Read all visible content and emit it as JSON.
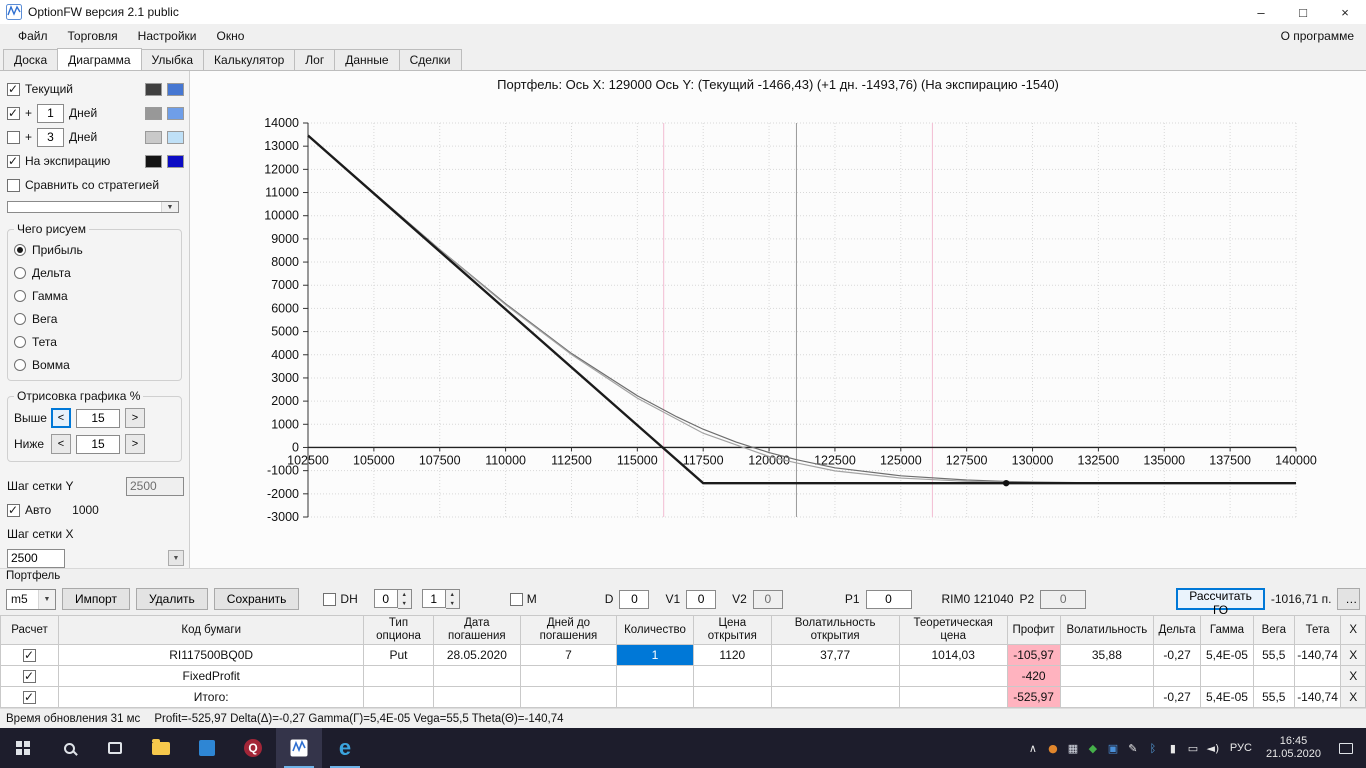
{
  "titlebar": {
    "title": "OptionFW версия 2.1 public",
    "minimize": "–",
    "maximize": "□",
    "close": "×"
  },
  "menubar": {
    "items": [
      {
        "id": "file",
        "label": "Файл"
      },
      {
        "id": "trading",
        "label": "Торговля"
      },
      {
        "id": "settings",
        "label": "Настройки"
      },
      {
        "id": "window",
        "label": "Окно"
      }
    ],
    "right": "О программе"
  },
  "tabs": {
    "items": [
      {
        "id": "board",
        "label": "Доска"
      },
      {
        "id": "diagram",
        "label": "Диаграмма"
      },
      {
        "id": "smile",
        "label": "Улыбка"
      },
      {
        "id": "calculator",
        "label": "Калькулятор"
      },
      {
        "id": "log",
        "label": "Лог"
      },
      {
        "id": "data",
        "label": "Данные"
      },
      {
        "id": "deals",
        "label": "Сделки"
      }
    ],
    "active_id": "diagram"
  },
  "sidebar": {
    "rows": {
      "current": {
        "label": "Текущий",
        "checked": true,
        "colors": [
          "#3f3f3f",
          "#4677d2"
        ]
      },
      "plus1": {
        "prefix": "+",
        "value": "1",
        "label": "Дней",
        "checked": true,
        "colors": [
          "#989898",
          "#6f9ee8"
        ]
      },
      "plus3": {
        "prefix": "+",
        "value": "3",
        "label": "Дней",
        "checked": false,
        "colors": [
          "#c9c9c9",
          "#bfe0f7"
        ]
      },
      "expiry": {
        "label": "На экспирацию",
        "checked": true,
        "colors": [
          "#141414",
          "#0b0bc4"
        ]
      },
      "compare": {
        "label": "Сравнить со стратегией",
        "checked": false
      }
    },
    "strategy_value": "",
    "draw_group": {
      "title": "Чего рисуем",
      "options": [
        {
          "id": "profit",
          "label": "Прибыль"
        },
        {
          "id": "delta",
          "label": "Дельта"
        },
        {
          "id": "gamma",
          "label": "Гамма"
        },
        {
          "id": "vega",
          "label": "Вега"
        },
        {
          "id": "theta",
          "label": "Тета"
        },
        {
          "id": "vomma",
          "label": "Вомма"
        }
      ],
      "selected": "profit"
    },
    "render_group": {
      "title": "Отрисовка графика %",
      "dec_label": "<",
      "inc_label": ">",
      "rows": [
        {
          "label": "Выше",
          "value": "15"
        },
        {
          "label": "Ниже",
          "value": "15"
        }
      ]
    },
    "grid_y": {
      "label": "Шаг сетки Y",
      "value": "2500"
    },
    "auto": {
      "label": "Авто",
      "value": "1000",
      "checked": true
    },
    "grid_x": {
      "label": "Шаг сетки X",
      "value": "2500"
    }
  },
  "chart_data": {
    "type": "line",
    "title": "Портфель:  Ось X: 129000 Ось Y:  (Текущий -1466,43)  (+1 дн. -1493,76)  (На экспирацию -1540)",
    "xlim": [
      102500,
      140000
    ],
    "ylim": [
      -3000,
      14000
    ],
    "x_tick_step": 2500,
    "y_tick_step": 1000,
    "grid": true,
    "series": [
      {
        "id": "current",
        "name": "Текущий",
        "color": "#6e6e6e",
        "width": 1.2,
        "points": [
          [
            102500,
            13465
          ],
          [
            105000,
            10991
          ],
          [
            107500,
            8544
          ],
          [
            110000,
            6201
          ],
          [
            112500,
            4058
          ],
          [
            115000,
            2232
          ],
          [
            116500,
            1321
          ],
          [
            117500,
            787
          ],
          [
            118750,
            232
          ],
          [
            120000,
            -218
          ],
          [
            121040,
            -526
          ],
          [
            122500,
            -877
          ],
          [
            125000,
            -1224
          ],
          [
            127500,
            -1405
          ],
          [
            129000,
            -1466
          ],
          [
            130000,
            -1492
          ],
          [
            132500,
            -1525
          ],
          [
            135000,
            -1536
          ],
          [
            140000,
            -1540
          ]
        ]
      },
      {
        "id": "plus1d",
        "name": "+1 дн.",
        "color": "#a3a3a3",
        "width": 1.2,
        "points": [
          [
            102500,
            13462
          ],
          [
            105000,
            10988
          ],
          [
            107500,
            8535
          ],
          [
            110000,
            6160
          ],
          [
            112500,
            4010
          ],
          [
            115000,
            2130
          ],
          [
            117500,
            615
          ],
          [
            120000,
            -389
          ],
          [
            121040,
            -669
          ],
          [
            122500,
            -1010
          ],
          [
            125000,
            -1320
          ],
          [
            127500,
            -1460
          ],
          [
            129000,
            -1494
          ],
          [
            130000,
            -1520
          ],
          [
            132500,
            -1535
          ],
          [
            135000,
            -1539
          ],
          [
            140000,
            -1540
          ]
        ]
      },
      {
        "id": "expiration",
        "name": "На экспирацию",
        "color": "#1b1b1b",
        "width": 2.4,
        "points": [
          [
            102500,
            13460
          ],
          [
            117500,
            -1540
          ],
          [
            140000,
            -1540
          ]
        ]
      }
    ],
    "vlines": [
      {
        "id": "lower-bound",
        "x": 116000,
        "color": "#f2bcd2"
      },
      {
        "id": "underlying-price",
        "x": 121040,
        "color": "#9b9b9b"
      },
      {
        "id": "upper-bound",
        "x": 126200,
        "color": "#f2bcd2"
      }
    ],
    "marker": {
      "x": 129000,
      "y": -1540,
      "color": "#111111"
    }
  },
  "portfolio": {
    "section_label": "Портфель",
    "preset_value": "m5",
    "import_button": "Импорт",
    "delete_button": "Удалить",
    "save_button": "Сохранить",
    "dh_label": "DH",
    "dh_spin1": "0",
    "dh_spin2": "1",
    "m_label": "M",
    "d_label": "D",
    "d_value": "0",
    "v1_label": "V1",
    "v1_value": "0",
    "v2_label": "V2",
    "v2_value": "0",
    "p1_label": "P1",
    "p1_value": "0",
    "rim_label": "RIM0 121040",
    "p2_label": "P2",
    "p2_value": "0",
    "calc_go_button": "Рассчитать ГО",
    "go_value": "-1016,71 п.",
    "more_button": "…"
  },
  "positions_table": {
    "headers": [
      "Расчет",
      "Код бумаги",
      "Тип опциона",
      "Дата погашения",
      "Дней до погашения",
      "Количество",
      "Цена открытия",
      "Волатильность открытия",
      "Теоретическая цена",
      "Профит",
      "Волатильность",
      "Дельта",
      "Гамма",
      "Вега",
      "Тета",
      "X"
    ],
    "close_label": "X",
    "rows": [
      {
        "checked": true,
        "selected_cell": 4,
        "cells": [
          "RI117500BQ0D",
          "Put",
          "28.05.2020",
          "7",
          "1",
          "1120",
          "37,77",
          "1014,03",
          "-105,97",
          "35,88",
          "-0,27",
          "5,4E-05",
          "55,5",
          "-140,74"
        ]
      },
      {
        "checked": true,
        "cells": [
          "FixedProfit",
          "",
          "",
          "",
          "",
          "",
          "",
          "",
          "-420",
          "",
          "",
          "",
          "",
          ""
        ]
      },
      {
        "checked": true,
        "cells": [
          "Итого:",
          "",
          "",
          "",
          "",
          "",
          "",
          "",
          "-525,97",
          "",
          "-0,27",
          "5,4E-05",
          "55,5",
          "-140,74"
        ]
      }
    ]
  },
  "statusbar": {
    "left": "Время обновления 31 мс",
    "right": "Profit=-525,97 Delta(Δ)=-0,27 Gamma(Γ)=5,4E-05 Vega=55,5 Theta(Θ)=-140,74"
  },
  "taskbar": {
    "apps": [
      {
        "id": "file-explorer",
        "type": "folder",
        "active": false
      },
      {
        "id": "store-app",
        "type": "blue",
        "active": false
      },
      {
        "id": "quik",
        "type": "q",
        "label": "Q",
        "active": false
      },
      {
        "id": "optionfw",
        "type": "chart",
        "active": true,
        "focused": true
      },
      {
        "id": "edge",
        "type": "e",
        "label": "e",
        "active": true
      }
    ],
    "tray_icons": [
      {
        "name": "hidden-icons-chevron",
        "glyph": "∧",
        "color": "#e8e8e8"
      },
      {
        "name": "tray-app-orange-icon",
        "glyph": "●",
        "color": "#e0862c"
      },
      {
        "name": "tray-app-grid-icon",
        "glyph": "▦",
        "color": "#d8dde6"
      },
      {
        "name": "antivirus-shield-icon",
        "glyph": "◆",
        "color": "#45b04a"
      },
      {
        "name": "tray-app-blue-icon",
        "glyph": "▣",
        "color": "#4a90d9"
      },
      {
        "name": "pen-icon",
        "glyph": "✎",
        "color": "#e8e8e8"
      },
      {
        "name": "bluetooth-icon",
        "glyph": "ᛒ",
        "color": "#5aa7e8"
      },
      {
        "name": "battery-icon",
        "glyph": "▮",
        "color": "#e8e8e8"
      },
      {
        "name": "network-icon",
        "glyph": "▭",
        "color": "#e8e8e8"
      },
      {
        "name": "volume-icon",
        "glyph": "◄)",
        "color": "#e8e8e8"
      }
    ],
    "lang": "РУС",
    "time": "16:45",
    "date": "21.05.2020"
  }
}
